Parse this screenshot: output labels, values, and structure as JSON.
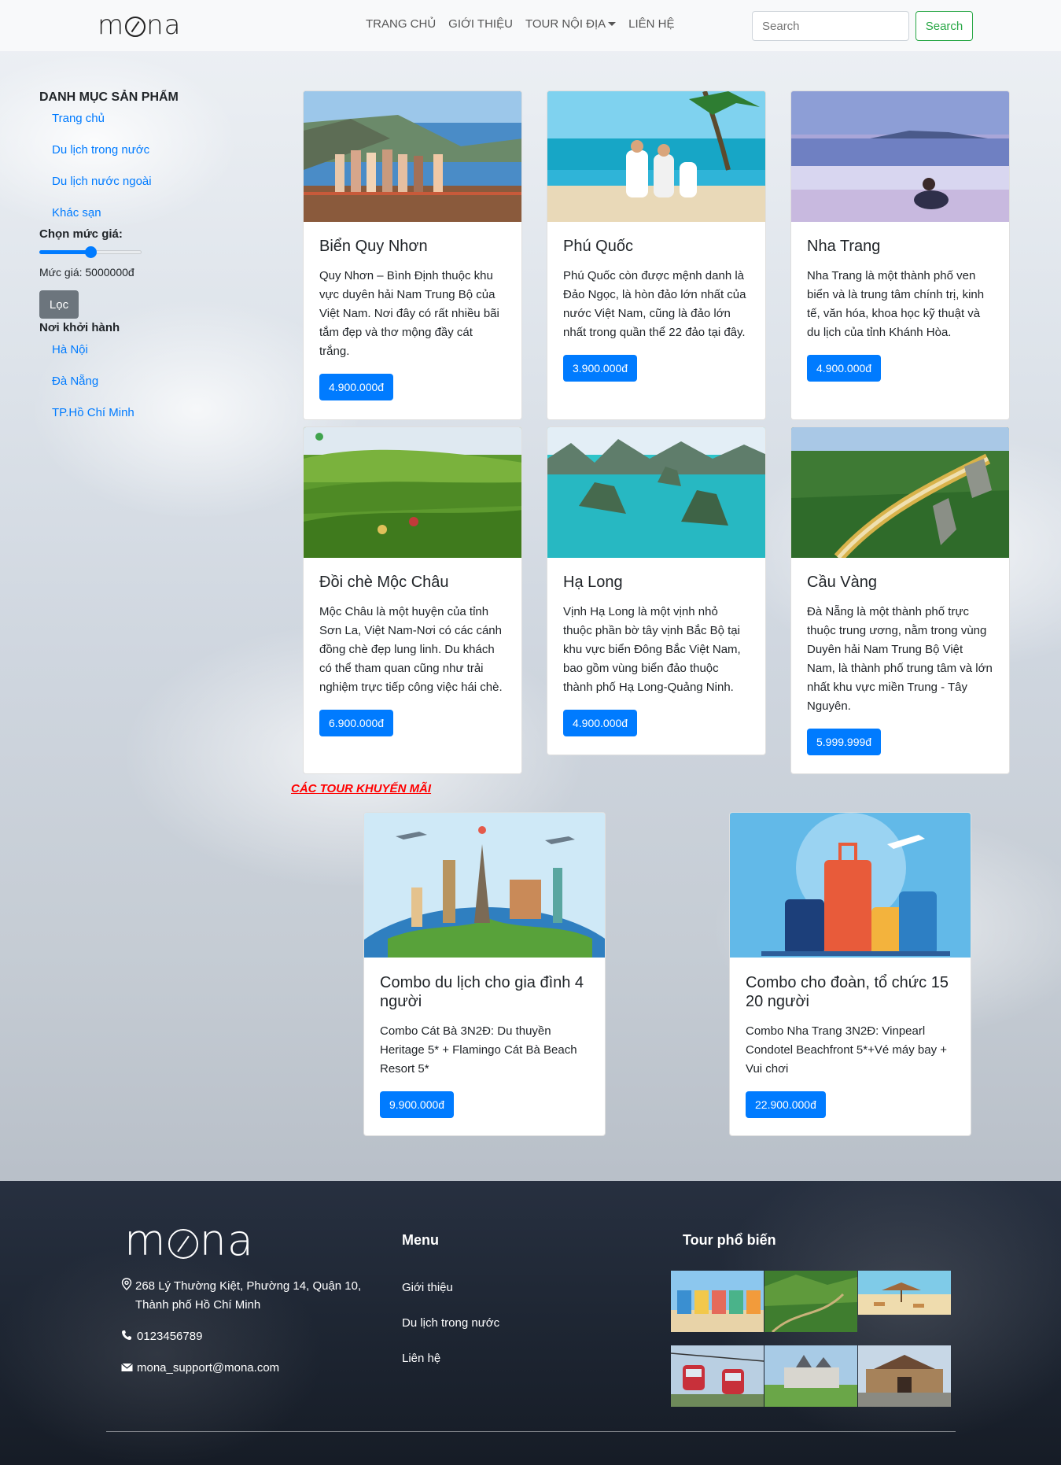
{
  "header": {
    "logo": "mona",
    "nav": [
      "TRANG CHỦ",
      "GIỚI THIỆU",
      "TOUR NỘI ĐỊA",
      "LIÊN HỆ"
    ],
    "search_placeholder": "Search",
    "search_button": "Search"
  },
  "sidebar": {
    "title": "DANH MỤC SẢN PHẨM",
    "categories": [
      "Trang chủ",
      "Du lịch trong nước",
      "Du lịch nước ngoài",
      "Khác sạn"
    ],
    "price_label": "Chọn mức giá:",
    "price_slider_fraction": 0.5,
    "price_value": "Mức giá: 5000000đ",
    "filter_button": "Lọc",
    "departure_title": "Nơi khởi hành",
    "departures": [
      "Hà Nội",
      "Đà Nẵng",
      "TP.Hồ Chí Minh"
    ]
  },
  "tours": [
    {
      "title": "Biển Quy Nhơn",
      "desc": "Quy Nhơn – Bình Định thuộc khu vực duyên hải Nam Trung Bộ của Việt Nam. Nơi đây có rất nhiều bãi tắm đẹp và thơ mộng đầy cát trắng.",
      "price": "4.900.000đ"
    },
    {
      "title": "Phú Quốc",
      "desc": "Phú Quốc còn được mệnh danh là Đảo Ngọc, là hòn đảo lớn nhất của nước Việt Nam, cũng là đảo lớn nhất trong quần thể 22 đảo tại đây.",
      "price": "3.900.000đ"
    },
    {
      "title": "Nha Trang",
      "desc": "Nha Trang là một thành phố ven biển và là trung tâm chính trị, kinh tế, văn hóa, khoa học kỹ thuật và du lịch của tỉnh Khánh Hòa.",
      "price": "4.900.000đ"
    },
    {
      "title": "Đồi chè Mộc Châu",
      "desc": "Mộc Châu là một huyện của tỉnh Sơn La, Việt Nam-Nơi có các cánh đồng chè đẹp lung linh. Du khách có thể tham quan cũng như trải nghiệm trực tiếp công việc hái chè.",
      "price": "6.900.000đ"
    },
    {
      "title": "Hạ Long",
      "desc": "Vịnh Hạ Long là một vịnh nhỏ thuộc phần bờ tây vịnh Bắc Bộ tại khu vực biển Đông Bắc Việt Nam, bao gồm vùng biển đảo thuộc thành phố Hạ Long-Quảng Ninh.",
      "price": "4.900.000đ"
    },
    {
      "title": "Cầu Vàng",
      "desc": "Đà Nẵng là một thành phố trực thuộc trung ương, nằm trong vùng Duyên hải Nam Trung Bộ Việt Nam, là thành phố trung tâm và lớn nhất khu vực miền Trung - Tây Nguyên.",
      "price": "5.999.999đ"
    }
  ],
  "promo": {
    "title": "CÁC TOUR KHUYẾN MÃI",
    "items": [
      {
        "title": "Combo du lịch cho gia đình 4 người",
        "desc": "Combo Cát Bà 3N2Đ: Du thuyền Heritage 5* + Flamingo Cát Bà Beach Resort 5*",
        "price": "9.900.000đ"
      },
      {
        "title": "Combo cho đoàn, tổ chức 15 20 người",
        "desc": "Combo Nha Trang 3N2Đ: Vinpearl Condotel Beachfront 5*+Vé máy bay + Vui chơi",
        "price": "22.900.000đ"
      }
    ]
  },
  "footer": {
    "logo": "mona",
    "address": "268 Lý Thường Kiệt, Phường 14, Quận 10, Thành phố Hồ Chí Minh",
    "phone": "0123456789",
    "email": "mona_support@mona.com",
    "menu_title": "Menu",
    "menu": [
      "Giới thiệu",
      "Du lịch trong nước",
      "Liên hệ"
    ],
    "popular_title": "Tour phổ biến"
  },
  "colors": {
    "primary": "#007bff",
    "success": "#28a745",
    "secondary": "#6c757d",
    "promo_red": "#ff0000"
  }
}
